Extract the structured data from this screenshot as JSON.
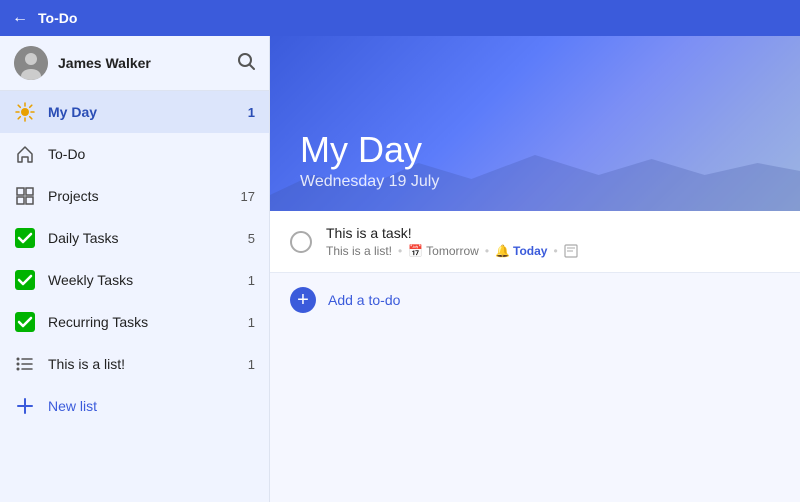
{
  "topbar": {
    "back_label": "←",
    "title": "To-Do"
  },
  "sidebar": {
    "user": {
      "name": "James Walker"
    },
    "search_icon": "🔍",
    "items": [
      {
        "id": "my-day",
        "label": "My Day",
        "count": "1",
        "active": true,
        "icon": "sun"
      },
      {
        "id": "to-do",
        "label": "To-Do",
        "count": "",
        "active": false,
        "icon": "home"
      },
      {
        "id": "projects",
        "label": "Projects",
        "count": "17",
        "active": false,
        "icon": "grid"
      },
      {
        "id": "daily-tasks",
        "label": "Daily Tasks",
        "count": "5",
        "active": false,
        "icon": "check-green"
      },
      {
        "id": "weekly-tasks",
        "label": "Weekly Tasks",
        "count": "1",
        "active": false,
        "icon": "check-green"
      },
      {
        "id": "recurring-tasks",
        "label": "Recurring Tasks",
        "count": "1",
        "active": false,
        "icon": "check-green"
      },
      {
        "id": "this-is-a-list",
        "label": "This is a list!",
        "count": "1",
        "active": false,
        "icon": "list"
      }
    ],
    "new_list_label": "New list"
  },
  "hero": {
    "title": "My Day",
    "date": "Wednesday 19 July"
  },
  "tasks": [
    {
      "id": "task-1",
      "title": "This is a task!",
      "list": "This is a list!",
      "due": "Tomorrow",
      "reminder": "Today",
      "has_note": true
    }
  ],
  "add_todo": {
    "label": "Add a to-do",
    "icon": "+"
  }
}
